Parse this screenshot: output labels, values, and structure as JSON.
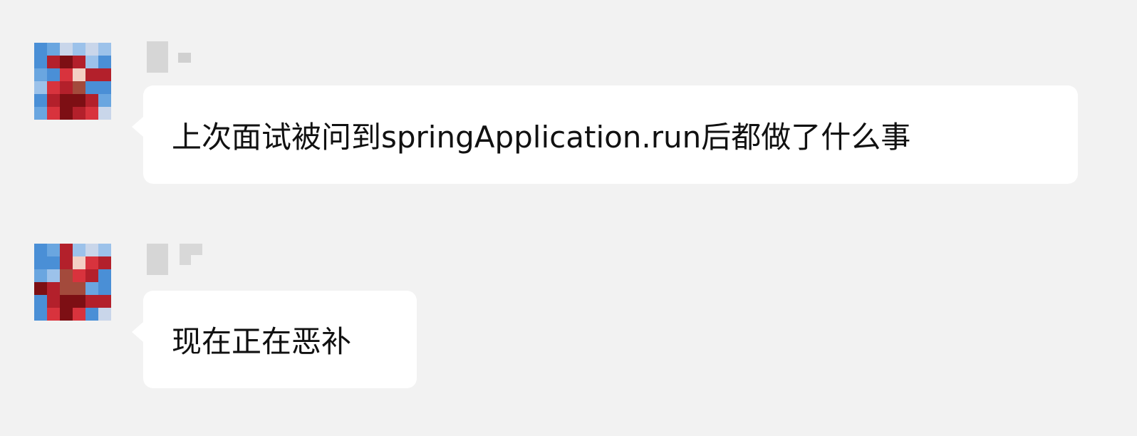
{
  "messages": [
    {
      "text": "上次面试被问到springApplication.run后都做了什么事"
    },
    {
      "text": "现在正在恶补"
    }
  ],
  "colors": {
    "background": "#f2f2f2",
    "bubble": "#ffffff",
    "text": "#111111",
    "avatar_palette": [
      "#4a8fd6",
      "#6aa6e0",
      "#9cc2ea",
      "#c9d6ea",
      "#b3202b",
      "#7d0f14",
      "#d8333d",
      "#f3d0c4",
      "#a34a3c"
    ]
  },
  "icons": [
    "avatar-image",
    "sender-name-redacted"
  ]
}
